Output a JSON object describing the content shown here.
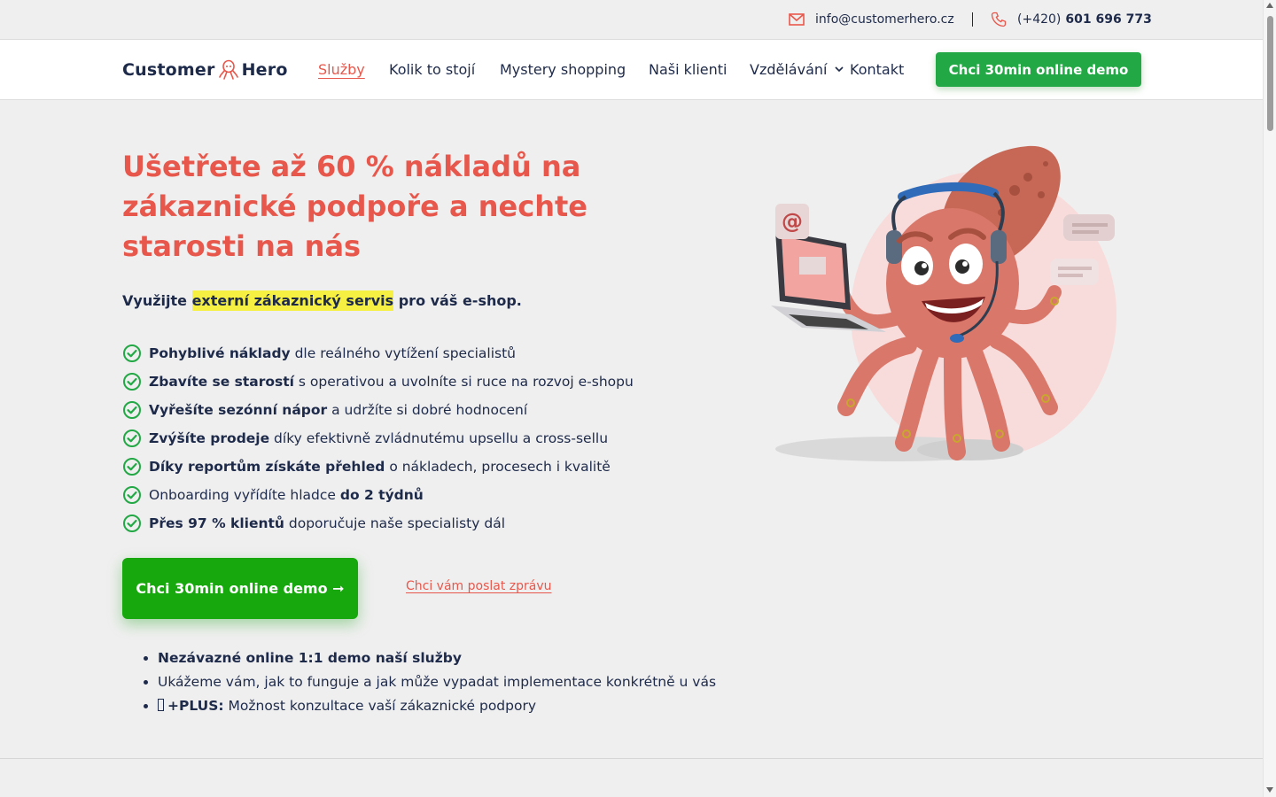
{
  "topbar": {
    "email": "info@customerhero.cz",
    "phone_prefix": "(+420)",
    "phone_number": "601 696 773"
  },
  "logo": {
    "left": "Customer",
    "right": "Hero"
  },
  "nav": {
    "items": [
      {
        "label": "Služby"
      },
      {
        "label": "Kolik to stojí"
      },
      {
        "label": "Mystery shopping"
      },
      {
        "label": "Naši klienti"
      },
      {
        "label": "Vzdělávání"
      },
      {
        "label": "Kontakt"
      }
    ],
    "cta": "Chci 30min online demo"
  },
  "hero": {
    "title": "Ušetřete až 60 % nákladů na zákaznické podpoře a nechte starosti na nás",
    "lead_before": "Využijte",
    "lead_highlight": "externí zákaznický servis",
    "lead_after": "pro váš e-shop.",
    "benefits": [
      {
        "bold": "Pohyblivé náklady",
        "text": " dle reálného vytížení specialistů"
      },
      {
        "bold": "Zbavíte se starostí",
        "text": " s operativou a uvolníte si ruce na rozvoj e-shopu"
      },
      {
        "bold": "Vyřešíte sezónní nápor",
        "text": " a udržíte si dobré hodnocení"
      },
      {
        "bold": "Zvýšíte prodeje",
        "text": " díky efektivně zvládnutému upsellu a cross-sellu"
      },
      {
        "bold": "Díky reportům získáte přehled",
        "text": " o nákladech, procesech i kvalitě"
      },
      {
        "pre": "Onboarding vyřídíte hladce ",
        "bold": "do 2 týdnů",
        "text": ""
      },
      {
        "bold": "Přes 97 % klientů",
        "text": " doporučuje naše specialisty dál"
      }
    ],
    "cta": "Chci 30min online demo ➞",
    "message_link": "Chci vám poslat zprávu",
    "demo_points": [
      {
        "bold": "Nezávazné online 1:1 demo naší služby",
        "text": ""
      },
      {
        "bold": "",
        "text": "Ukážeme vám, jak to funguje a jak může vypadat implementace konkrétně u vás"
      },
      {
        "bold": "+PLUS:",
        "text": " Možnost konzultace vaší zákaznické podpory"
      }
    ]
  },
  "icons": {
    "mail": "mail-icon",
    "phone": "phone-icon",
    "check": "check-circle-icon",
    "logo": "octopus-logo-icon",
    "chevron": "chevron-down-icon"
  },
  "colors": {
    "accent": "#e8574b",
    "cta_green": "#22a845",
    "hero_cta_green": "#17a80e",
    "text_navy": "#1e2a4a",
    "highlight": "#f5f041"
  }
}
